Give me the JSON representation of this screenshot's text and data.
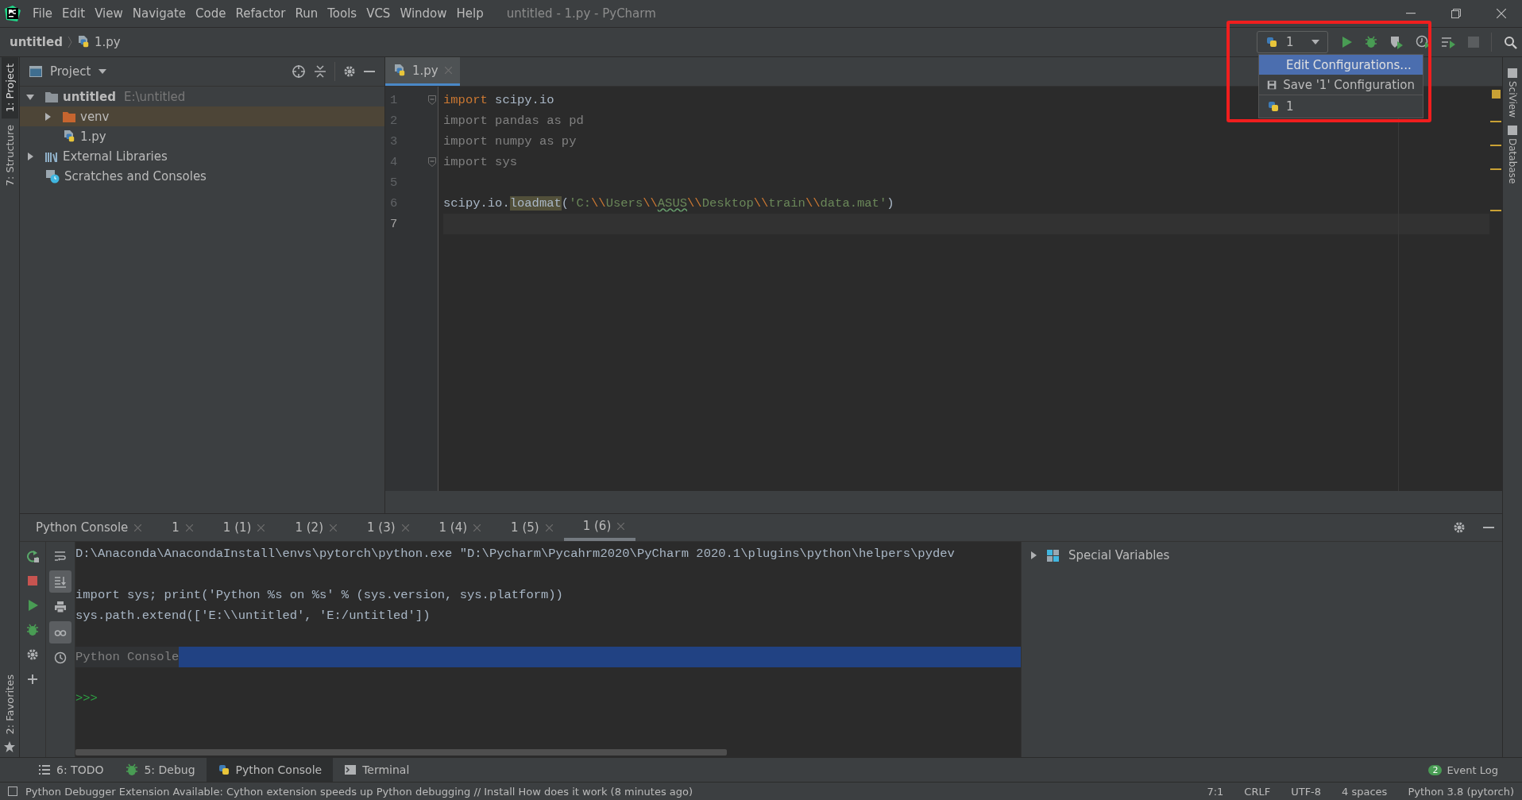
{
  "window": {
    "title": "untitled - 1.py - PyCharm"
  },
  "menu": [
    "File",
    "Edit",
    "View",
    "Navigate",
    "Code",
    "Refactor",
    "Run",
    "Tools",
    "VCS",
    "Window",
    "Help"
  ],
  "breadcrumbs": [
    "untitled",
    "1.py"
  ],
  "run_toolbar": {
    "config": "1"
  },
  "config_menu": [
    {
      "label": "Edit Configurations...",
      "kind": "action",
      "selected": true
    },
    {
      "label": "Save '1' Configuration",
      "kind": "save",
      "selected": false
    },
    {
      "label": "1",
      "kind": "config",
      "selected": false
    }
  ],
  "left_strip": [
    {
      "label": "1: Project",
      "selected": true
    },
    {
      "label": "7: Structure",
      "selected": false
    }
  ],
  "favorites": {
    "label": "2: Favorites"
  },
  "right_strip": [
    {
      "label": "SciView"
    },
    {
      "label": "Database"
    }
  ],
  "project_panel": {
    "title": "Project",
    "tree": [
      {
        "label": "untitled",
        "path": "E:\\untitled",
        "kind": "folder",
        "expanded": true,
        "selected": false,
        "children": [
          {
            "label": "venv",
            "kind": "venv",
            "expanded": false,
            "selected": true
          },
          {
            "label": "1.py",
            "kind": "python",
            "selected": false
          }
        ]
      },
      {
        "label": "External Libraries",
        "kind": "libraries",
        "expanded": false,
        "selected": false
      },
      {
        "label": "Scratches and Consoles",
        "kind": "scratches",
        "selected": false
      }
    ]
  },
  "editor": {
    "tabs": [
      {
        "label": "1.py",
        "selected": true
      }
    ],
    "lines": [
      {
        "number": "1",
        "fold": true,
        "current": false,
        "tokens": [
          {
            "text": "import",
            "kind": "kw"
          },
          {
            "text": " scipy.io",
            "kind": "id"
          }
        ]
      },
      {
        "number": "2",
        "fold": false,
        "current": false,
        "tokens": [
          {
            "text": "import pandas as pd",
            "kind": "unused"
          }
        ]
      },
      {
        "number": "3",
        "fold": false,
        "current": false,
        "tokens": [
          {
            "text": "import numpy as py",
            "kind": "unused"
          }
        ]
      },
      {
        "number": "4",
        "fold": true,
        "current": false,
        "tokens": [
          {
            "text": "import sys",
            "kind": "unused"
          }
        ]
      },
      {
        "number": "5",
        "fold": false,
        "current": false
      },
      {
        "number": "6",
        "fold": false,
        "current": false,
        "tokens": [
          {
            "text": "scipy.io.",
            "kind": "id"
          },
          {
            "text": "loadmat",
            "kind": "match"
          },
          {
            "text": "(",
            "kind": "id"
          },
          {
            "text": "'C:",
            "kind": "str"
          },
          {
            "text": "\\\\",
            "kind": "esc"
          },
          {
            "text": "Users",
            "kind": "str"
          },
          {
            "text": "\\\\",
            "kind": "esc"
          },
          {
            "text": "ASUS",
            "kind": "typo"
          },
          {
            "text": "\\\\",
            "kind": "esc"
          },
          {
            "text": "Desktop",
            "kind": "str"
          },
          {
            "text": "\\\\",
            "kind": "esc"
          },
          {
            "text": "train",
            "kind": "str"
          },
          {
            "text": "\\\\",
            "kind": "esc"
          },
          {
            "text": "data.mat'",
            "kind": "str"
          },
          {
            "text": ")",
            "kind": "id"
          }
        ]
      },
      {
        "number": "7",
        "fold": false,
        "current": true
      }
    ]
  },
  "console_tabs": [
    {
      "label": "Python Console",
      "selected": false
    },
    {
      "label": "1",
      "selected": false
    },
    {
      "label": "1 (1)",
      "selected": false
    },
    {
      "label": "1 (2)",
      "selected": false
    },
    {
      "label": "1 (3)",
      "selected": false
    },
    {
      "label": "1 (4)",
      "selected": false
    },
    {
      "label": "1 (5)",
      "selected": false
    },
    {
      "label": "1 (6)",
      "selected": true
    }
  ],
  "console_actions": [
    {
      "kind": "rerun"
    },
    {
      "kind": "stop"
    },
    {
      "kind": "run"
    },
    {
      "kind": "debug"
    },
    {
      "kind": "settings"
    },
    {
      "kind": "add"
    }
  ],
  "console_tools": [
    {
      "kind": "wrap",
      "on": false
    },
    {
      "kind": "scroll-end",
      "on": true
    },
    {
      "kind": "print",
      "on": false
    },
    {
      "kind": "glasses",
      "on": true
    },
    {
      "kind": "history",
      "on": false
    }
  ],
  "console": {
    "lines": [
      {
        "kind": "output",
        "text": "D:\\Anaconda\\AnacondaInstall\\envs\\pytorch\\python.exe \"D:\\Pycharm\\Pycahrm2020\\PyCharm 2020.1\\plugins\\python\\helpers\\pydev"
      },
      {
        "kind": "blank"
      },
      {
        "kind": "output",
        "text": "import sys; print('Python %s on %s' % (sys.version, sys.platform))"
      },
      {
        "kind": "output",
        "text": "sys.path.extend(['E:\\\\untitled', 'E:/untitled'])"
      },
      {
        "kind": "blank"
      },
      {
        "kind": "banner",
        "text": "Python Console"
      },
      {
        "kind": "blank"
      },
      {
        "kind": "prompt",
        "text": ">>>"
      }
    ]
  },
  "variables": [
    {
      "label": "Special Variables",
      "expanded": false
    }
  ],
  "tool_tabs": [
    {
      "label": "6: TODO",
      "kind": "list",
      "selected": false
    },
    {
      "label": "5: Debug",
      "kind": "debug",
      "selected": false
    },
    {
      "label": "Python Console",
      "kind": "python",
      "selected": true
    },
    {
      "label": "Terminal",
      "kind": "terminal",
      "selected": false
    }
  ],
  "event_log": {
    "label": "Event Log",
    "count": "2"
  },
  "status": {
    "message": "Python Debugger Extension Available: Cython extension speeds up Python debugging // Install   How does it work (8 minutes ago)",
    "items": [
      "7:1",
      "CRLF",
      "UTF-8",
      "4 spaces",
      "Python 3.8 (pytorch)"
    ]
  }
}
